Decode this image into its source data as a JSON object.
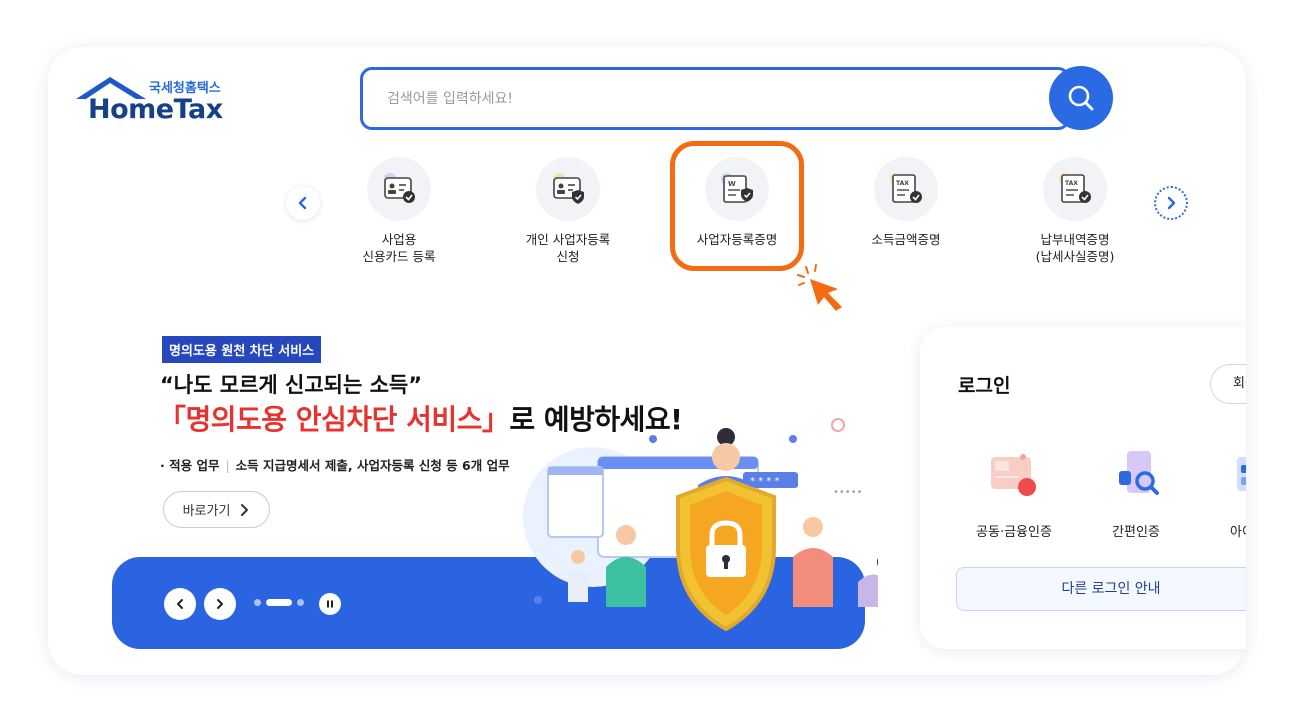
{
  "logo": {
    "tagline": "국세청홈택스",
    "wordmark": "HomeTax"
  },
  "search": {
    "placeholder": "검색어를 입력하세요!",
    "button_icon": "search-icon"
  },
  "services": [
    {
      "label": "사업용\n신용카드 등록",
      "icon": "id-card-check-icon"
    },
    {
      "label": "개인 사업자등록\n신청",
      "icon": "id-card-check-icon"
    },
    {
      "label": "사업자등록증명",
      "icon": "document-shield-icon",
      "highlighted": true
    },
    {
      "label": "소득금액증명",
      "icon": "tax-document-check-icon"
    },
    {
      "label": "납부내역증명\n(납세사실증명)",
      "icon": "tax-document-check-icon"
    }
  ],
  "banner": {
    "badge": "명의도용 원천 차단 서비스",
    "headline": "“나도 모르게 신고되는 소득”",
    "title_red": "「명의도용 안심차단 서비스」",
    "title_rest": "로 예방하세요!",
    "tasks_label": "· 적용 업무",
    "tasks_detail": "소득 지급명세서 제출, 사업자등록 신청 등 6개 업무",
    "go_label": "바로가기",
    "slides_total": 3,
    "slide_active": 2
  },
  "login": {
    "title": "로그인",
    "join_label": "회원가입",
    "methods": [
      {
        "label": "공동·금융인증",
        "icon": "certificate-icon"
      },
      {
        "label": "간편인증",
        "icon": "phone-search-icon"
      },
      {
        "label": "아이디",
        "icon": "id-icon"
      }
    ],
    "other_label": "다른 로그인 안내"
  },
  "colors": {
    "primary": "#2a6ae3",
    "highlight": "#f46b11",
    "badge": "#2747bd",
    "accent_red": "#e8322f"
  }
}
